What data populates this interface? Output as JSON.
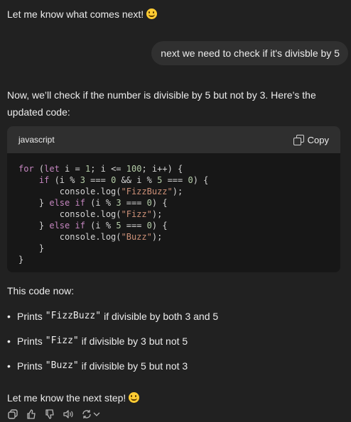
{
  "messages": {
    "assistant_intro": "Let me know what comes next!",
    "user_message": "next we need to check if it's divisble by 5",
    "assistant_para": "Now, we’ll check if the number is divisible by 5 but not by 3. Here’s the updated code:",
    "code_lang": "javascript",
    "copy_label": "Copy",
    "code_intro": "This code now:",
    "bullets": [
      {
        "prefix": "Prints",
        "code": "\"FizzBuzz\"",
        "suffix": "if divisible by both 3 and 5"
      },
      {
        "prefix": "Prints",
        "code": "\"Fizz\"",
        "suffix": "if divisible by 3 but not 5"
      },
      {
        "prefix": "Prints",
        "code": "\"Buzz\"",
        "suffix": "if divisible by 5 but not 3"
      }
    ],
    "closing": "Let me know the next step!"
  },
  "code_lines": [
    "for (let i = 1; i <= 100; i++) {",
    "    if (i % 3 === 0 && i % 5 === 0) {",
    "        console.log(\"FizzBuzz\");",
    "    } else if (i % 3 === 0) {",
    "        console.log(\"Fizz\");",
    "    } else if (i % 5 === 0) {",
    "        console.log(\"Buzz\");",
    "    }",
    "}"
  ],
  "actions": [
    "copy-icon",
    "thumbs-up-icon",
    "thumbs-down-icon",
    "read-aloud-icon",
    "regenerate-icon"
  ],
  "colors": {
    "background": "#212121",
    "bubble": "#303030",
    "code_bg": "#171717",
    "code_header": "#2f2f2f",
    "keyword": "#c586c0",
    "number": "#b5cea8",
    "string": "#ce9178"
  }
}
